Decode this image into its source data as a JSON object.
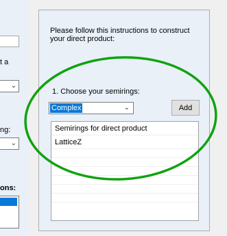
{
  "left_panel": {
    "fragment_a": "t a",
    "fragment_ng": "ng:",
    "fragment_ons": "ons:"
  },
  "panel": {
    "instructions": "Please follow this instructions to construct your direct product:",
    "step1_label": "1. Choose your semirings:",
    "semiring_select": {
      "selected": "Complex"
    },
    "add_label": "Add",
    "list": {
      "header": "Semirings for direct product",
      "items": [
        "LatticeZ"
      ]
    }
  },
  "colors": {
    "selection": "#0a78d7",
    "annotation": "#0fa30f"
  }
}
